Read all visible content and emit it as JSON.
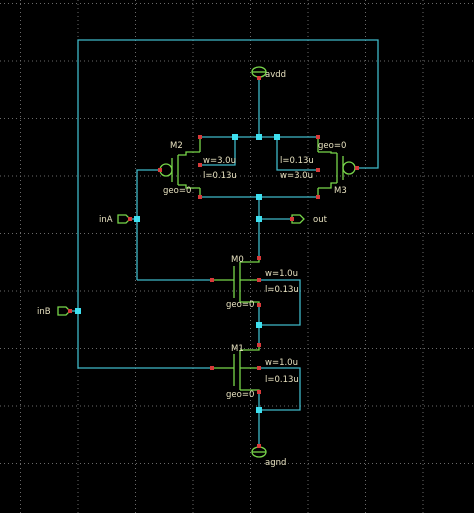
{
  "pins": {
    "avdd": "avdd",
    "agnd": "agnd",
    "inA": "inA",
    "inB": "inB",
    "out": "out"
  },
  "transistors": {
    "M2": {
      "name": "M2",
      "w": "w=3.0u",
      "l": "l=0.13u",
      "geo": "geo=0"
    },
    "M3": {
      "name": "M3",
      "l": "l=0.13u",
      "w": "w=3.0u",
      "geo": "geo=0"
    },
    "M0": {
      "name": "M0",
      "w": "w=1.0u",
      "l": "l=0.13u",
      "geo": "geo=0"
    },
    "M1": {
      "name": "M1",
      "w": "w=1.0u",
      "l": "l=0.13u",
      "geo": "geo=0"
    }
  },
  "colors": {
    "background": "#000000",
    "grid": "#6a6a6a",
    "wire": "#3fb8c8",
    "device": "#78d64a",
    "pin_red": "#d83a3a",
    "text": "#e8e2c0",
    "junction": "#3fe0f0"
  }
}
